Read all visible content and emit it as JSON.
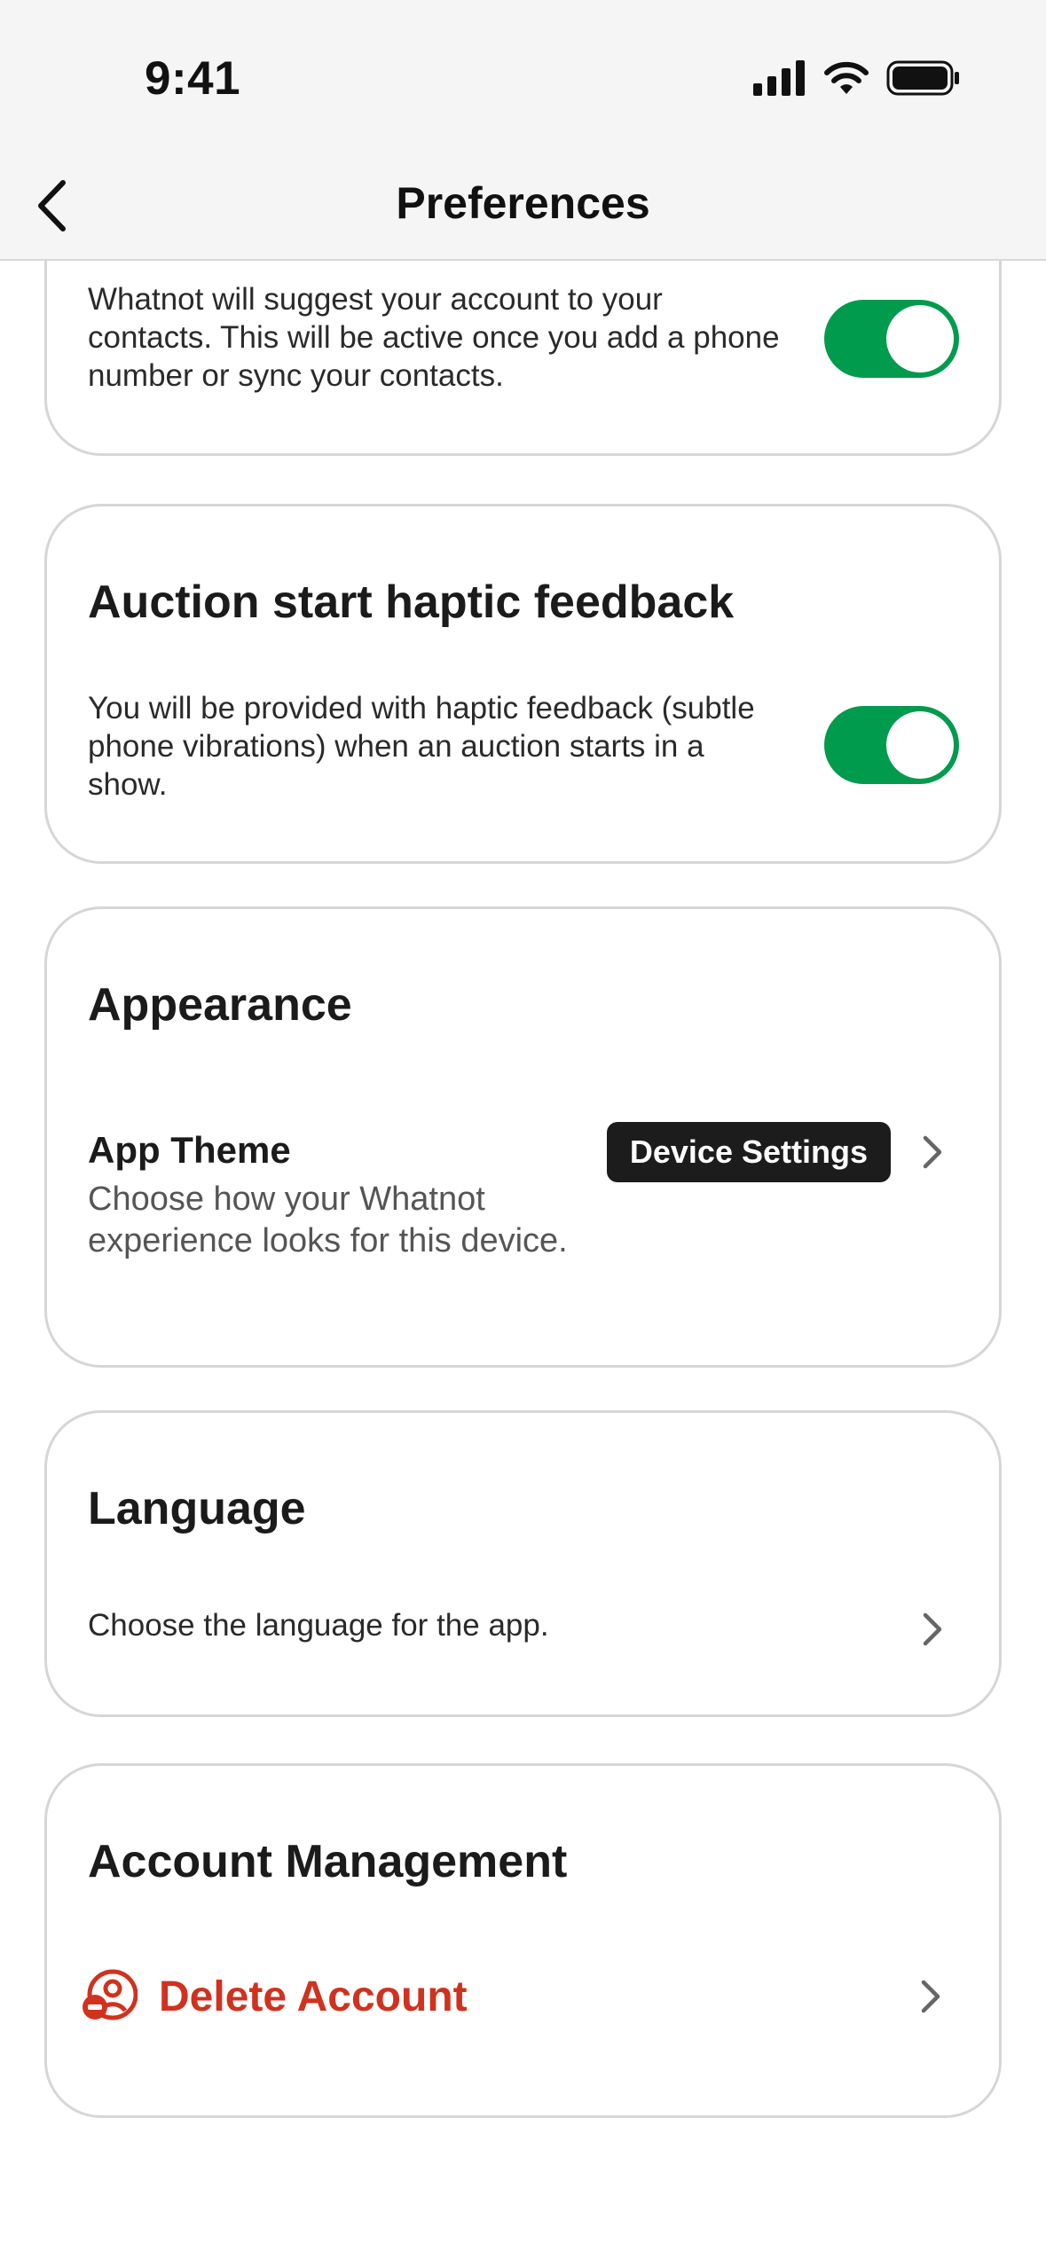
{
  "status_bar": {
    "time": "9:41"
  },
  "nav": {
    "title": "Preferences",
    "back_icon": "chevron-left-icon"
  },
  "cards": {
    "contacts": {
      "description": "Whatnot will suggest your account to your contacts. This will be active once you add a phone number or sync your contacts.",
      "toggle_on": true
    },
    "haptic": {
      "title": "Auction start haptic feedback",
      "description": "You will be provided with haptic feedback (subtle phone vibrations) when an auction starts in a show.",
      "toggle_on": true
    },
    "appearance": {
      "title": "Appearance",
      "row_label": "App Theme",
      "row_description": "Choose how your Whatnot experience looks for this device.",
      "theme_value": "Device Settings"
    },
    "language": {
      "title": "Language",
      "description": "Choose the language for the app."
    },
    "account": {
      "title": "Account Management",
      "delete_label": "Delete Account",
      "delete_icon": "remove-user-icon"
    }
  },
  "colors": {
    "toggle_on": "#009b4d",
    "danger": "#d0321f",
    "badge_bg": "#1c1c1c",
    "card_border": "#d6d6d6"
  }
}
